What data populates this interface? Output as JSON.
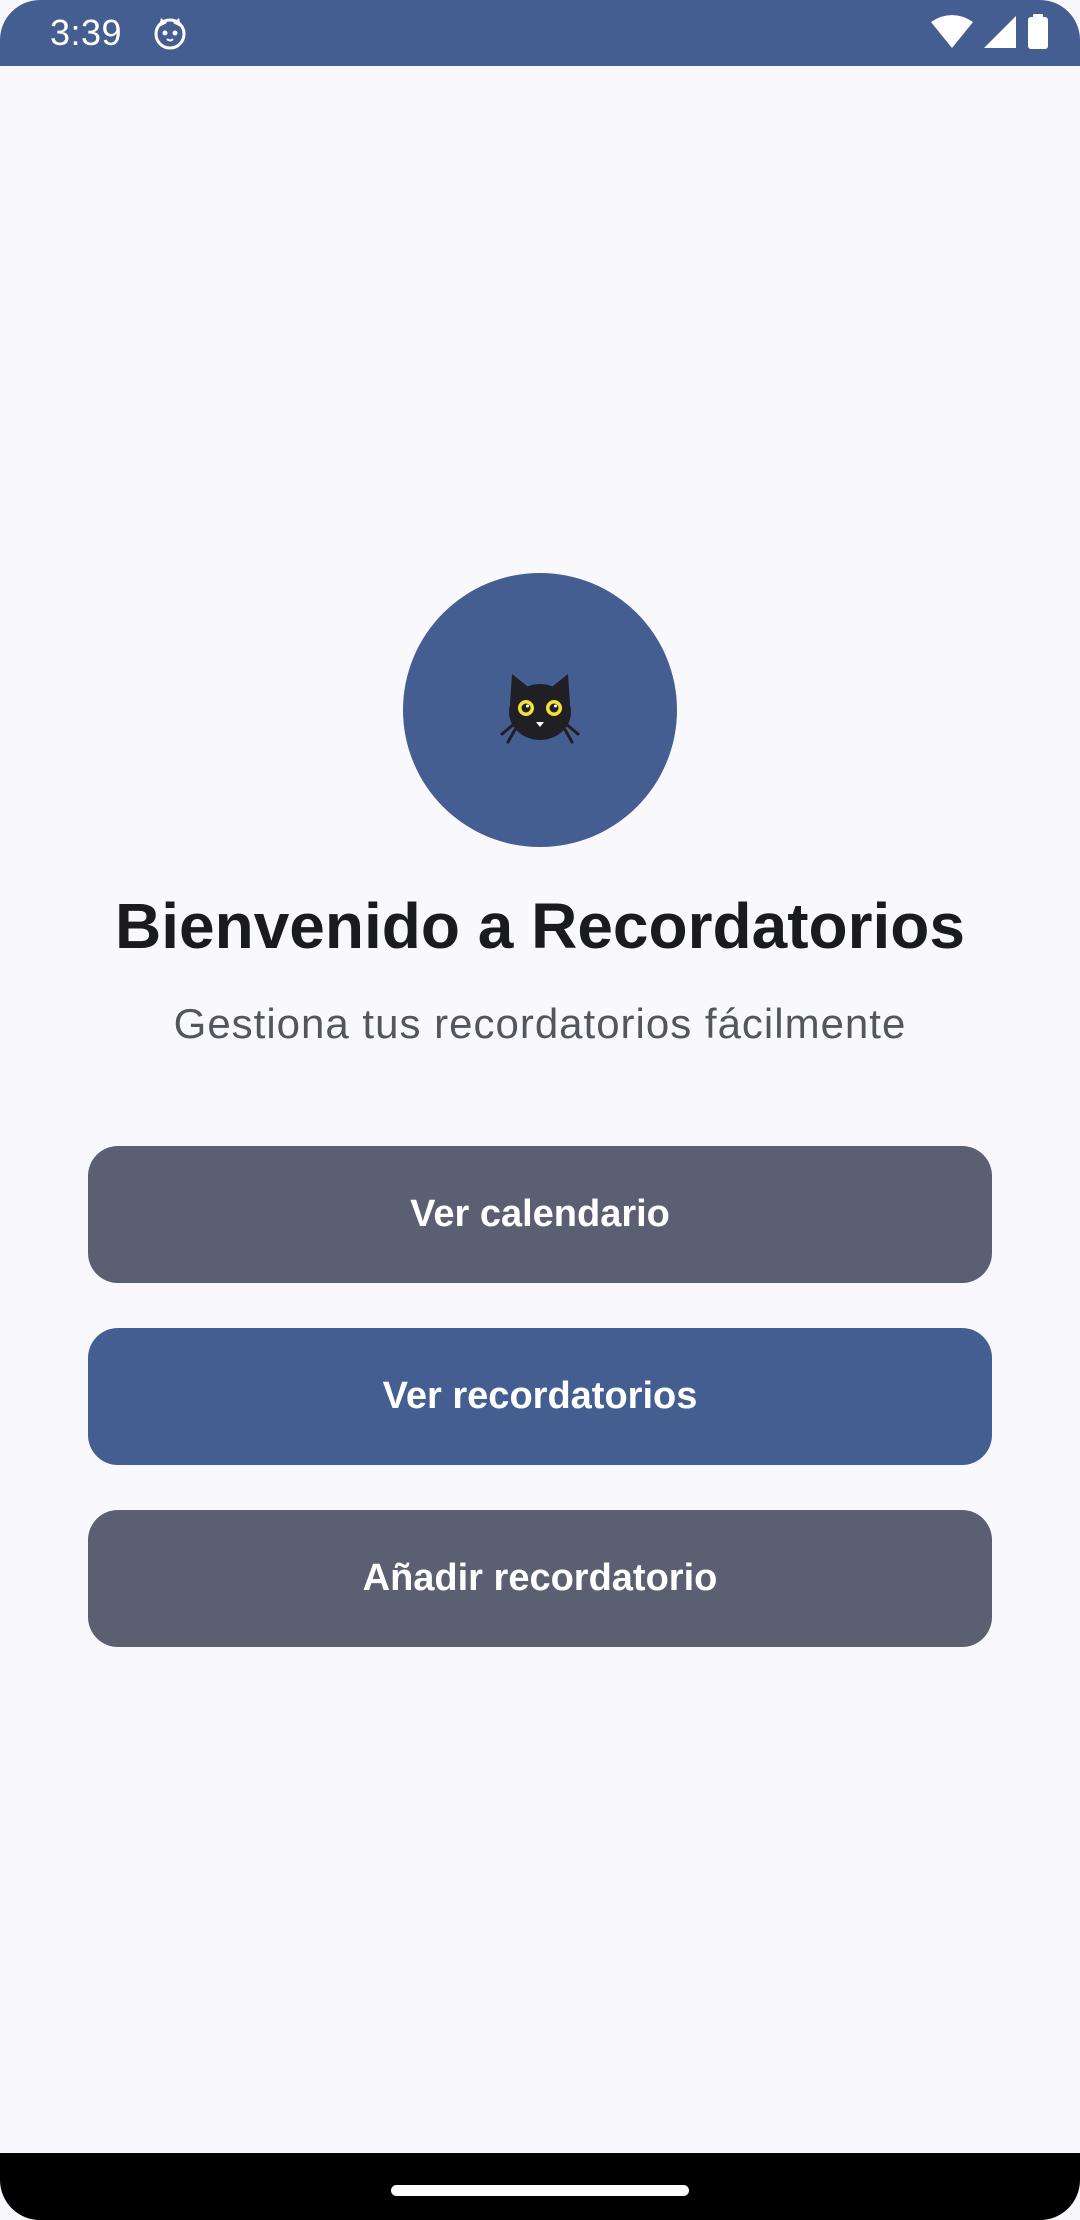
{
  "status_bar": {
    "time": "3:39",
    "app_icon": "cat-face-icon",
    "icons": [
      "wifi-icon",
      "cellular-signal-icon",
      "battery-icon"
    ],
    "background": "#455e91"
  },
  "welcome": {
    "avatar_icon": "black-cat-icon",
    "title": "Bienvenido a Recordatorios",
    "subtitle": "Gestiona tus recordatorios fácilmente"
  },
  "actions": {
    "calendar_label": "Ver calendario",
    "reminders_label": "Ver recordatorios",
    "add_label": "Añadir recordatorio"
  },
  "colors": {
    "primary": "#455e91",
    "secondary": "#5a5f72",
    "background": "#f9f8fd",
    "title_text": "#1a1b20",
    "subtitle_text": "#54565e"
  },
  "nav_bar": {
    "handle": "gesture-handle"
  }
}
